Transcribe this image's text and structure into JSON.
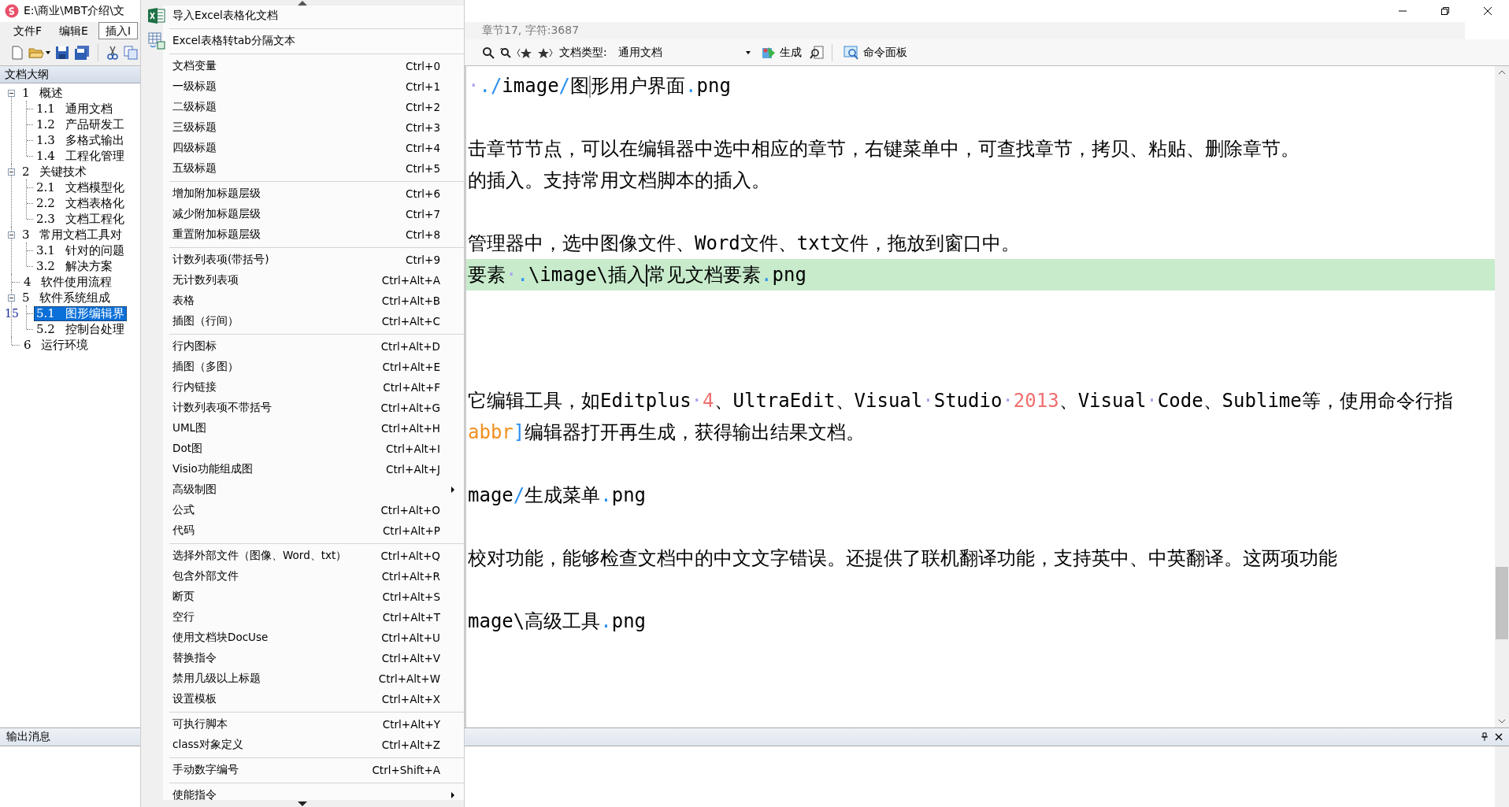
{
  "window": {
    "title": "E:\\商业\\MBT介绍\\文"
  },
  "menubar": [
    {
      "label": "文件F",
      "selected": false
    },
    {
      "label": "编辑E",
      "selected": false
    },
    {
      "label": "插入I",
      "selected": true
    }
  ],
  "status": "章节17, 字符:3687",
  "doc_toolbar": {
    "doc_type_label": "文档类型:",
    "doc_type": "通用文档",
    "build": "生成",
    "command_panel": "命令面板"
  },
  "outline": {
    "title": "文档大纲",
    "tree": [
      {
        "label": "1 概述",
        "expanded": true,
        "selected": false,
        "children": [
          {
            "label": "1.1 通用文档",
            "selected": false
          },
          {
            "label": "1.2 产品研发工",
            "selected": false
          },
          {
            "label": "1.3 多格式输出",
            "selected": false
          },
          {
            "label": "1.4 工程化管理",
            "selected": false
          }
        ]
      },
      {
        "label": "2 关键技术",
        "expanded": true,
        "selected": false,
        "children": [
          {
            "label": "2.1 文档模型化",
            "selected": false
          },
          {
            "label": "2.2 文档表格化",
            "selected": false
          },
          {
            "label": "2.3 文档工程化",
            "selected": false
          }
        ]
      },
      {
        "label": "3 常用文档工具对",
        "expanded": true,
        "selected": false,
        "children": [
          {
            "label": "3.1 针对的问题",
            "selected": false
          },
          {
            "label": "3.2 解决方案",
            "selected": false
          }
        ]
      },
      {
        "label": "4 软件使用流程",
        "selected": false
      },
      {
        "label": "5 软件系统组成",
        "expanded": true,
        "selected": false,
        "children": [
          {
            "label": "5.1 图形编辑界",
            "selected": true,
            "gutter": "15"
          },
          {
            "label": "5.2 控制台处理",
            "selected": false
          }
        ]
      },
      {
        "label": "6 运行环境",
        "selected": false
      }
    ]
  },
  "editor": {
    "lines": [
      {
        "kind": "text",
        "highlighted": false,
        "segments": [
          {
            "kind": "space",
            "text": "·"
          },
          {
            "kind": "path",
            "text": "./"
          },
          {
            "kind": "text",
            "text": "image"
          },
          {
            "kind": "path",
            "text": "/"
          },
          {
            "kind": "text",
            "text": "图"
          },
          {
            "kind": "caret",
            "focused": false
          },
          {
            "kind": "text",
            "text": "形用户界面"
          },
          {
            "kind": "path",
            "text": "."
          },
          {
            "kind": "text",
            "text": "png"
          }
        ]
      },
      {
        "kind": "blank"
      },
      {
        "kind": "text",
        "highlighted": false,
        "segments": [
          {
            "kind": "text",
            "text": "击章节节点，可以在编辑器中选中相应的章节，右键菜单中，可查找章节，拷贝、粘贴、删除章节。"
          }
        ]
      },
      {
        "kind": "text",
        "highlighted": false,
        "segments": [
          {
            "kind": "text",
            "text": "的插入。支持常用文档脚本的插入。"
          }
        ]
      },
      {
        "kind": "blank"
      },
      {
        "kind": "text",
        "highlighted": false,
        "segments": [
          {
            "kind": "text",
            "text": "管理器中，选中图像文件、Word文件、txt文件，拖放到窗口中。"
          }
        ]
      },
      {
        "kind": "text",
        "highlighted": true,
        "segments": [
          {
            "kind": "text",
            "text": "要素"
          },
          {
            "kind": "space",
            "text": "·"
          },
          {
            "kind": "path",
            "text": "."
          },
          {
            "kind": "text",
            "text": "\\image\\插入"
          },
          {
            "kind": "caret",
            "focused": true
          },
          {
            "kind": "text",
            "text": "常见文档要素"
          },
          {
            "kind": "path",
            "text": "."
          },
          {
            "kind": "text",
            "text": "png"
          }
        ]
      },
      {
        "kind": "blank"
      },
      {
        "kind": "blank"
      },
      {
        "kind": "blank"
      },
      {
        "kind": "text",
        "highlighted": false,
        "segments": [
          {
            "kind": "text",
            "text": "它编辑工具，如Editplus"
          },
          {
            "kind": "space",
            "text": "·"
          },
          {
            "kind": "number",
            "text": "4"
          },
          {
            "kind": "text",
            "text": "、UltraEdit、Visual"
          },
          {
            "kind": "space",
            "text": "·"
          },
          {
            "kind": "text",
            "text": "Studio"
          },
          {
            "kind": "space",
            "text": "·"
          },
          {
            "kind": "number",
            "text": "2013"
          },
          {
            "kind": "text",
            "text": "、Visual"
          },
          {
            "kind": "space",
            "text": "·"
          },
          {
            "kind": "text",
            "text": "Code、Sublime等，使用命令行指"
          }
        ]
      },
      {
        "kind": "text",
        "highlighted": false,
        "segments": [
          {
            "kind": "tag",
            "text": "abbr"
          },
          {
            "kind": "path",
            "text": "]"
          },
          {
            "kind": "text",
            "text": "编辑器打开再生成，获得输出结果文档。"
          }
        ]
      },
      {
        "kind": "blank"
      },
      {
        "kind": "text",
        "highlighted": false,
        "segments": [
          {
            "kind": "text",
            "text": "mage"
          },
          {
            "kind": "path",
            "text": "/"
          },
          {
            "kind": "text",
            "text": "生成菜单"
          },
          {
            "kind": "path",
            "text": "."
          },
          {
            "kind": "text",
            "text": "png"
          }
        ]
      },
      {
        "kind": "blank"
      },
      {
        "kind": "text",
        "highlighted": false,
        "segments": [
          {
            "kind": "text",
            "text": "校对功能，能够检查文档中的中文文字错误。还提供了联机翻译功能，支持英中、中英翻译。这两项功能"
          }
        ]
      },
      {
        "kind": "blank"
      },
      {
        "kind": "text",
        "highlighted": false,
        "segments": [
          {
            "kind": "text",
            "text": "mage\\高级工具"
          },
          {
            "kind": "path",
            "text": "."
          },
          {
            "kind": "text",
            "text": "png"
          }
        ]
      }
    ]
  },
  "output": {
    "title": "输出消息"
  },
  "context_menu": {
    "groups": [
      [
        {
          "label": "导入Excel表格化文档"
        }
      ],
      [
        {
          "label": "Excel表格转tab分隔文本"
        }
      ],
      [
        {
          "label": "文档变量",
          "shortcut": "Ctrl+0"
        },
        {
          "label": "一级标题",
          "shortcut": "Ctrl+1"
        },
        {
          "label": "二级标题",
          "shortcut": "Ctrl+2"
        },
        {
          "label": "三级标题",
          "shortcut": "Ctrl+3"
        },
        {
          "label": "四级标题",
          "shortcut": "Ctrl+4"
        },
        {
          "label": "五级标题",
          "shortcut": "Ctrl+5"
        }
      ],
      [
        {
          "label": "增加附加标题层级",
          "shortcut": "Ctrl+6"
        },
        {
          "label": "减少附加标题层级",
          "shortcut": "Ctrl+7"
        },
        {
          "label": "重置附加标题层级",
          "shortcut": "Ctrl+8"
        }
      ],
      [
        {
          "label": "计数列表项(带括号)",
          "shortcut": "Ctrl+9"
        },
        {
          "label": "无计数列表项",
          "shortcut": "Ctrl+Alt+A"
        },
        {
          "label": "表格",
          "shortcut": "Ctrl+Alt+B"
        },
        {
          "label": "插图（行间）",
          "shortcut": "Ctrl+Alt+C"
        }
      ],
      [
        {
          "label": "行内图标",
          "shortcut": "Ctrl+Alt+D"
        },
        {
          "label": "插图（多图）",
          "shortcut": "Ctrl+Alt+E"
        },
        {
          "label": "行内链接",
          "shortcut": "Ctrl+Alt+F"
        },
        {
          "label": "计数列表项不带括号",
          "shortcut": "Ctrl+Alt+G"
        },
        {
          "label": "UML图",
          "shortcut": "Ctrl+Alt+H"
        },
        {
          "label": "Dot图",
          "shortcut": "Ctrl+Alt+I"
        },
        {
          "label": "Visio功能组成图",
          "shortcut": "Ctrl+Alt+J"
        },
        {
          "label": "高级制图",
          "submenu": true
        },
        {
          "label": "公式",
          "shortcut": "Ctrl+Alt+O"
        },
        {
          "label": "代码",
          "shortcut": "Ctrl+Alt+P"
        }
      ],
      [
        {
          "label": "选择外部文件（图像、Word、txt）",
          "shortcut": "Ctrl+Alt+Q"
        },
        {
          "label": "包含外部文件",
          "shortcut": "Ctrl+Alt+R"
        },
        {
          "label": "断页",
          "shortcut": "Ctrl+Alt+S"
        },
        {
          "label": "空行",
          "shortcut": "Ctrl+Alt+T"
        },
        {
          "label": "使用文档块DocUse",
          "shortcut": "Ctrl+Alt+U"
        },
        {
          "label": "替换指令",
          "shortcut": "Ctrl+Alt+V"
        },
        {
          "label": "禁用几级以上标题",
          "shortcut": "Ctrl+Alt+W"
        },
        {
          "label": "设置模板",
          "shortcut": "Ctrl+Alt+X"
        }
      ],
      [
        {
          "label": "可执行脚本",
          "shortcut": "Ctrl+Alt+Y"
        },
        {
          "label": "class对象定义",
          "shortcut": "Ctrl+Alt+Z"
        }
      ],
      [
        {
          "label": "手动数字编号",
          "shortcut": "Ctrl+Shift+A"
        }
      ],
      [
        {
          "label": "使能指令",
          "submenu": true
        }
      ]
    ]
  }
}
